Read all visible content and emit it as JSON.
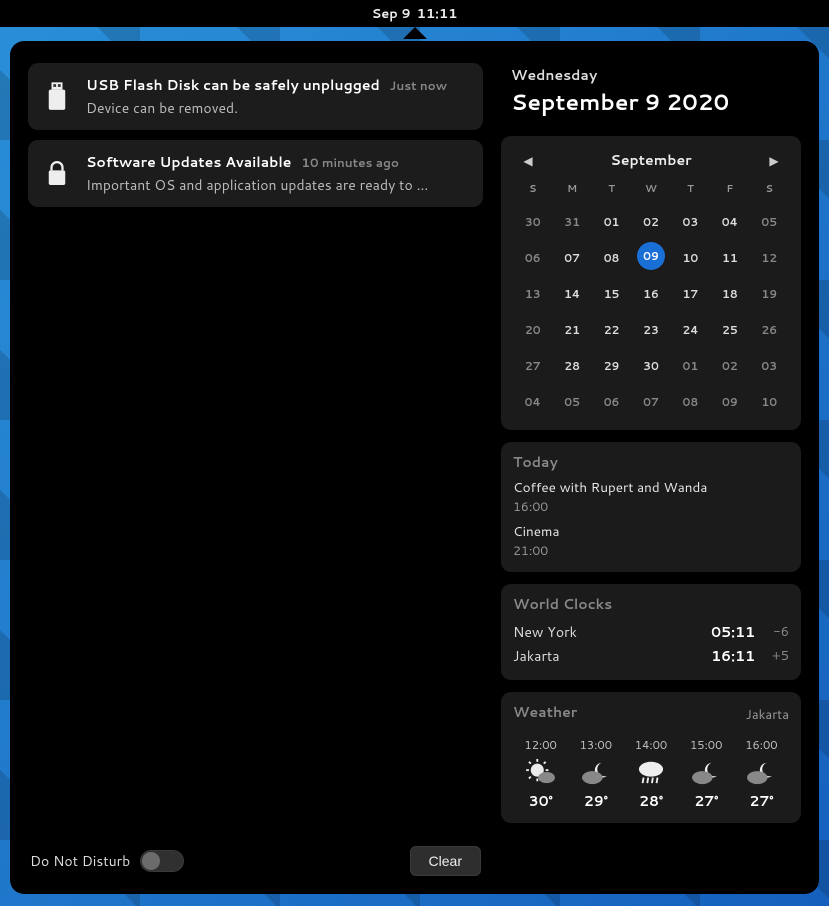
{
  "topbar": {
    "date": "Sep 9",
    "time": "11:11"
  },
  "notifications": [
    {
      "icon": "usb-icon",
      "title": "USB Flash Disk can be safely unplugged",
      "time": "Just now",
      "desc": "Device can be removed."
    },
    {
      "icon": "lock-icon",
      "title": "Software Updates Available",
      "time": "10 minutes ago",
      "desc": "Important OS and application updates are ready to …"
    }
  ],
  "dnd_label": "Do Not Disturb",
  "clear_label": "Clear",
  "header": {
    "dow": "Wednesday",
    "full": "September 9 2020"
  },
  "calendar": {
    "month": "September",
    "weekdays": [
      "S",
      "M",
      "T",
      "W",
      "T",
      "F",
      "S"
    ],
    "cells": [
      {
        "n": "30",
        "in": false
      },
      {
        "n": "31",
        "in": false
      },
      {
        "n": "01",
        "in": true
      },
      {
        "n": "02",
        "in": true
      },
      {
        "n": "03",
        "in": true
      },
      {
        "n": "04",
        "in": true
      },
      {
        "n": "05",
        "in": false
      },
      {
        "n": "06",
        "in": false
      },
      {
        "n": "07",
        "in": true
      },
      {
        "n": "08",
        "in": true
      },
      {
        "n": "09",
        "in": true,
        "today": true
      },
      {
        "n": "10",
        "in": true
      },
      {
        "n": "11",
        "in": true
      },
      {
        "n": "12",
        "in": false
      },
      {
        "n": "13",
        "in": false
      },
      {
        "n": "14",
        "in": true
      },
      {
        "n": "15",
        "in": true
      },
      {
        "n": "16",
        "in": true
      },
      {
        "n": "17",
        "in": true
      },
      {
        "n": "18",
        "in": true
      },
      {
        "n": "19",
        "in": false
      },
      {
        "n": "20",
        "in": false
      },
      {
        "n": "21",
        "in": true
      },
      {
        "n": "22",
        "in": true
      },
      {
        "n": "23",
        "in": true
      },
      {
        "n": "24",
        "in": true
      },
      {
        "n": "25",
        "in": true
      },
      {
        "n": "26",
        "in": false
      },
      {
        "n": "27",
        "in": false
      },
      {
        "n": "28",
        "in": true
      },
      {
        "n": "29",
        "in": true
      },
      {
        "n": "30",
        "in": true
      },
      {
        "n": "01",
        "in": false
      },
      {
        "n": "02",
        "in": false
      },
      {
        "n": "03",
        "in": false
      },
      {
        "n": "04",
        "in": false
      },
      {
        "n": "05",
        "in": false
      },
      {
        "n": "06",
        "in": false
      },
      {
        "n": "07",
        "in": false
      },
      {
        "n": "08",
        "in": false
      },
      {
        "n": "09",
        "in": false
      },
      {
        "n": "10",
        "in": false
      }
    ]
  },
  "today": {
    "heading": "Today",
    "events": [
      {
        "title": "Coffee with Rupert and Wanda",
        "time": "16:00"
      },
      {
        "title": "Cinema",
        "time": "21:00"
      }
    ]
  },
  "clocks": {
    "heading": "World Clocks",
    "items": [
      {
        "city": "New York",
        "time": "05:11",
        "offset": "-6"
      },
      {
        "city": "Jakarta",
        "time": "16:11",
        "offset": "+5"
      }
    ]
  },
  "weather": {
    "heading": "Weather",
    "city": "Jakarta",
    "hours": [
      {
        "h": "12:00",
        "cond": "sun",
        "temp": "30°"
      },
      {
        "h": "13:00",
        "cond": "cloud-moon",
        "temp": "29°"
      },
      {
        "h": "14:00",
        "cond": "rain",
        "temp": "28°"
      },
      {
        "h": "15:00",
        "cond": "cloud-moon",
        "temp": "27°"
      },
      {
        "h": "16:00",
        "cond": "cloud-moon",
        "temp": "27°"
      }
    ]
  }
}
